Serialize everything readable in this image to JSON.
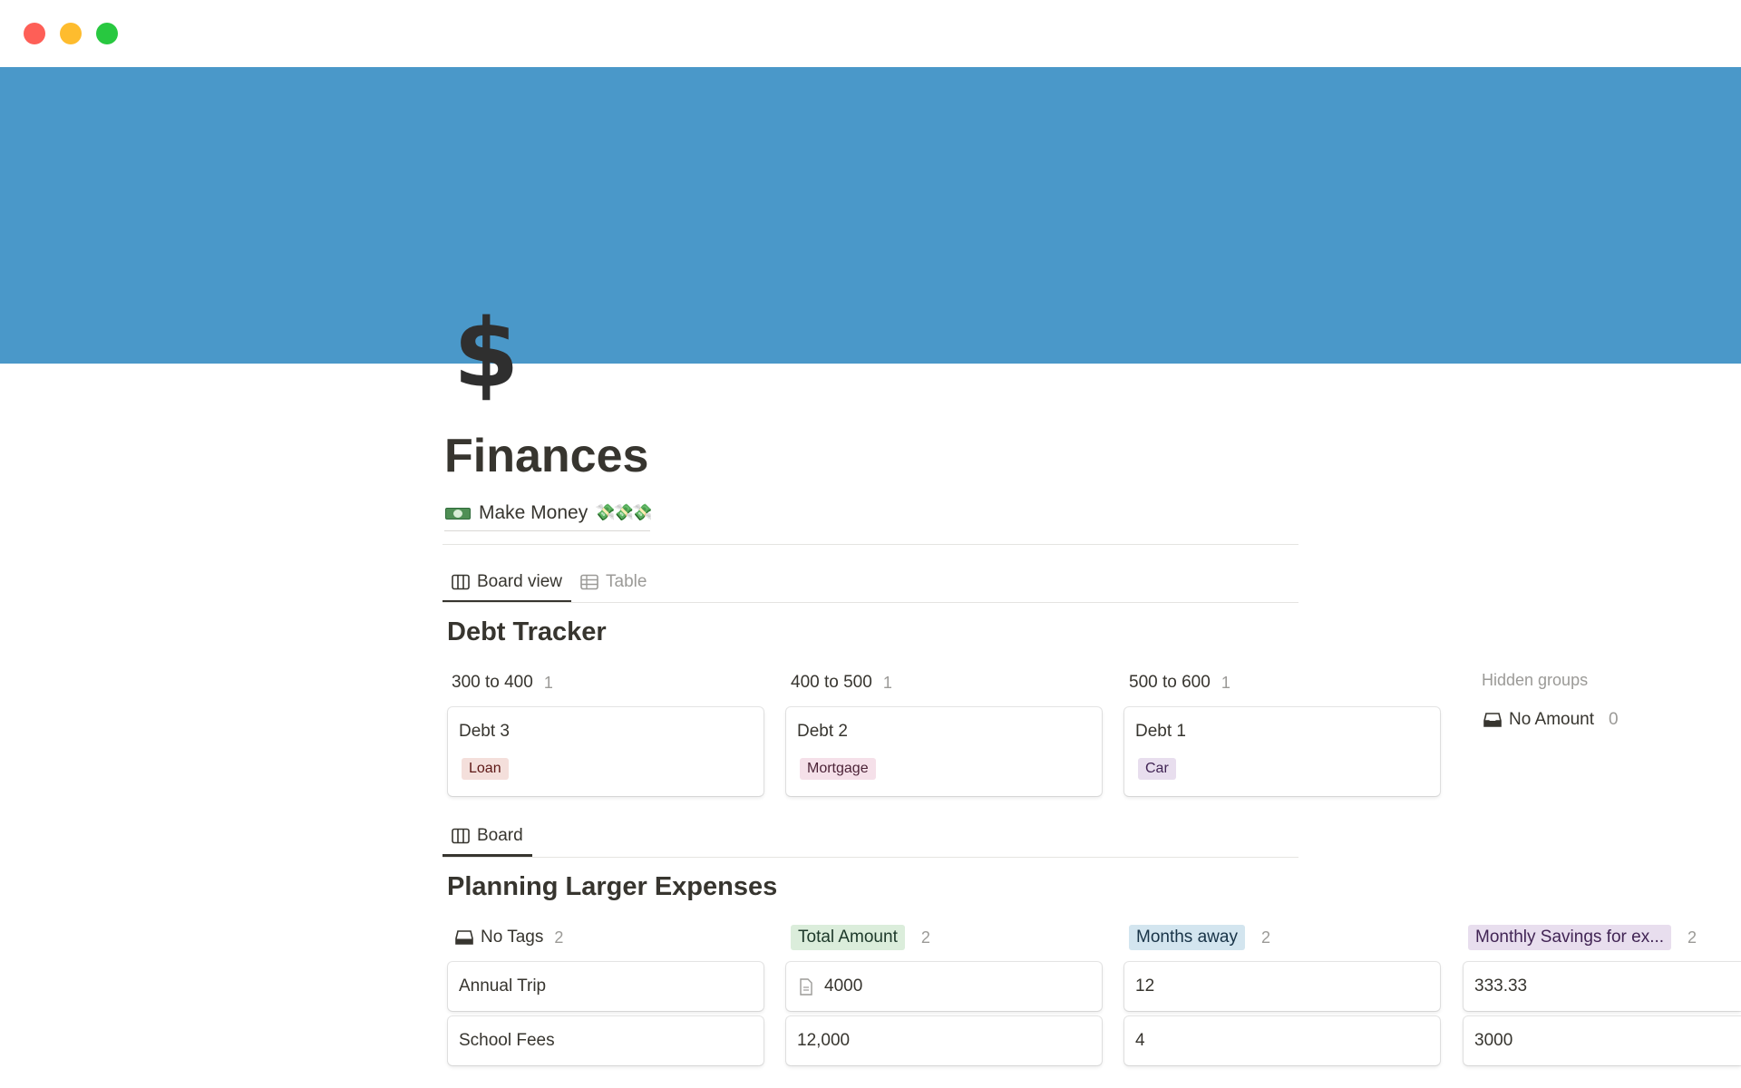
{
  "window": {
    "controls": [
      "close",
      "minimize",
      "maximize"
    ]
  },
  "cover": {
    "color": "#4a98c9"
  },
  "page": {
    "icon": "$",
    "title": "Finances",
    "link": {
      "icon": "money-with-wings-icon",
      "label": "Make Money",
      "trailing_emojis": "💸💸💸"
    }
  },
  "debt_tracker": {
    "tabs": [
      {
        "label": "Board view",
        "icon": "board-icon",
        "active": true
      },
      {
        "label": "Table",
        "icon": "table-icon",
        "active": false
      }
    ],
    "title": "Debt Tracker",
    "columns": [
      {
        "label": "300 to 400",
        "count": "1",
        "cards": [
          {
            "title": "Debt 3",
            "tag": "Loan"
          }
        ]
      },
      {
        "label": "400 to 500",
        "count": "1",
        "cards": [
          {
            "title": "Debt 2",
            "tag": "Mortgage"
          }
        ]
      },
      {
        "label": "500 to 600",
        "count": "1",
        "cards": [
          {
            "title": "Debt 1",
            "tag": "Car"
          }
        ]
      }
    ],
    "hidden_groups": {
      "label": "Hidden groups",
      "items": [
        {
          "label": "No Amount",
          "count": "0",
          "icon": "inbox-icon"
        }
      ]
    }
  },
  "planning": {
    "tabs": [
      {
        "label": "Board",
        "icon": "board-icon",
        "active": true
      }
    ],
    "title": "Planning Larger Expenses",
    "columns": [
      {
        "label": "No Tags",
        "count": "2",
        "icon": "inbox-icon",
        "color": null,
        "cards": [
          "Annual Trip",
          "School Fees"
        ]
      },
      {
        "label": "Total Amount",
        "count": "2",
        "color": "#dbeddb",
        "cards": [
          "4000",
          "12,000"
        ]
      },
      {
        "label": "Months away",
        "count": "2",
        "color": "#d3e5ef",
        "cards": [
          "12",
          "4"
        ]
      },
      {
        "label": "Monthly Savings for ex...",
        "count": "2",
        "color": "#e8deee",
        "cards": [
          "333.33",
          "3000"
        ]
      }
    ]
  },
  "colors": {
    "text": "#37352f",
    "muted": "#9b9a97",
    "tag_loan": "#f4dfdb",
    "tag_mortgage": "#f5e0e9",
    "tag_car": "#e8deee"
  }
}
